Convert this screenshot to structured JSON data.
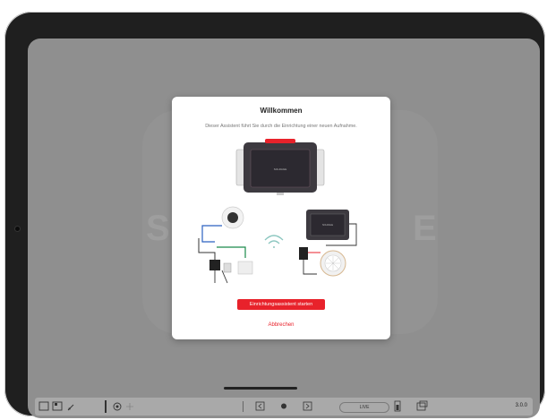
{
  "modal": {
    "title": "Willkommen",
    "subtitle": "Dieser Assistent führt Sie durch die Einrichtung einer neuen Aufnahme.",
    "device_label": "SOLDAGE",
    "start_label": "Einrichtungsassistent starten",
    "cancel_label": "Abbrechen"
  },
  "background": {
    "letter_left": "S",
    "letter_right": "E"
  },
  "toolbar": {
    "live_label": "LIVE",
    "version": "3.0.0"
  },
  "colors": {
    "accent": "#e8222b",
    "overlay": "#8f8f8f",
    "toolbar": "#a9a9a9"
  }
}
